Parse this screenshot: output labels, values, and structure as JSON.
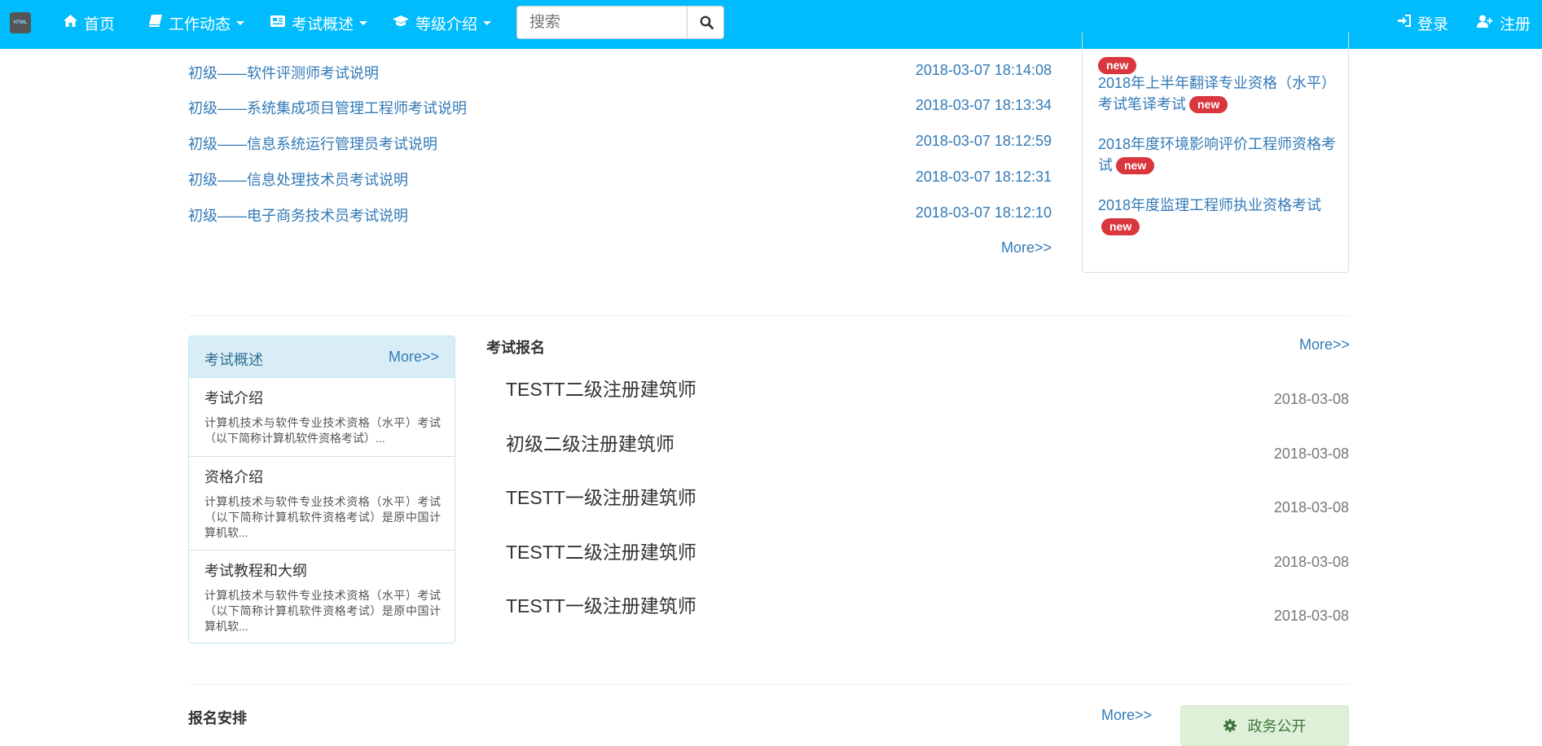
{
  "nav": {
    "logo_text": "HTML",
    "home": "首页",
    "work": "工作动态",
    "exam": "考试概述",
    "level": "等级介绍",
    "search_placeholder": "搜索",
    "login": "登录",
    "register": "注册",
    "bar_color": "#00bcfc"
  },
  "news": {
    "items": [
      {
        "title": "初级——软件评测师考试说明",
        "date": "2018-03-07 18:14:08"
      },
      {
        "title": "初级——系统集成项目管理工程师考试说明",
        "date": "2018-03-07 18:13:34"
      },
      {
        "title": "初级——信息系统运行管理员考试说明",
        "date": "2018-03-07 18:12:59"
      },
      {
        "title": "初级——信息处理技术员考试说明",
        "date": "2018-03-07 18:12:31"
      },
      {
        "title": "初级——电子商务技术员考试说明",
        "date": "2018-03-07 18:12:10"
      }
    ],
    "more": "More>>"
  },
  "side": {
    "items": [
      {
        "title": "",
        "badge": "new"
      },
      {
        "title": "2018年上半年翻译专业资格（水平）考试笔译考试",
        "badge": "new"
      },
      {
        "title": "2018年度环境影响评价工程师资格考试",
        "badge": "new"
      },
      {
        "title": "2018年度监理工程师执业资格考试",
        "badge": "new"
      }
    ]
  },
  "overview": {
    "title": "考试概述",
    "more": "More>>",
    "items": [
      {
        "title": "考试介绍",
        "summary": "计算机技术与软件专业技术资格（水平）考试（以下简称计算机软件资格考试）..."
      },
      {
        "title": "资格介绍",
        "summary": "计算机技术与软件专业技术资格（水平）考试（以下简称计算机软件资格考试）是原中国计算机软..."
      },
      {
        "title": "考试教程和大纲",
        "summary": "计算机技术与软件专业技术资格（水平）考试（以下简称计算机软件资格考试）是原中国计算机软..."
      }
    ]
  },
  "registration": {
    "title": "考试报名",
    "more": "More>>",
    "items": [
      {
        "title": "TESTT二级注册建筑师",
        "date": "2018-03-08"
      },
      {
        "title": "初级二级注册建筑师",
        "date": "2018-03-08"
      },
      {
        "title": "TESTT一级注册建筑师",
        "date": "2018-03-08"
      },
      {
        "title": "TESTT二级注册建筑师",
        "date": "2018-03-08"
      },
      {
        "title": "TESTT一级注册建筑师",
        "date": "2018-03-08"
      }
    ]
  },
  "schedule": {
    "title": "报名安排",
    "more": "More>>"
  },
  "gov": {
    "label": "政务公开"
  }
}
